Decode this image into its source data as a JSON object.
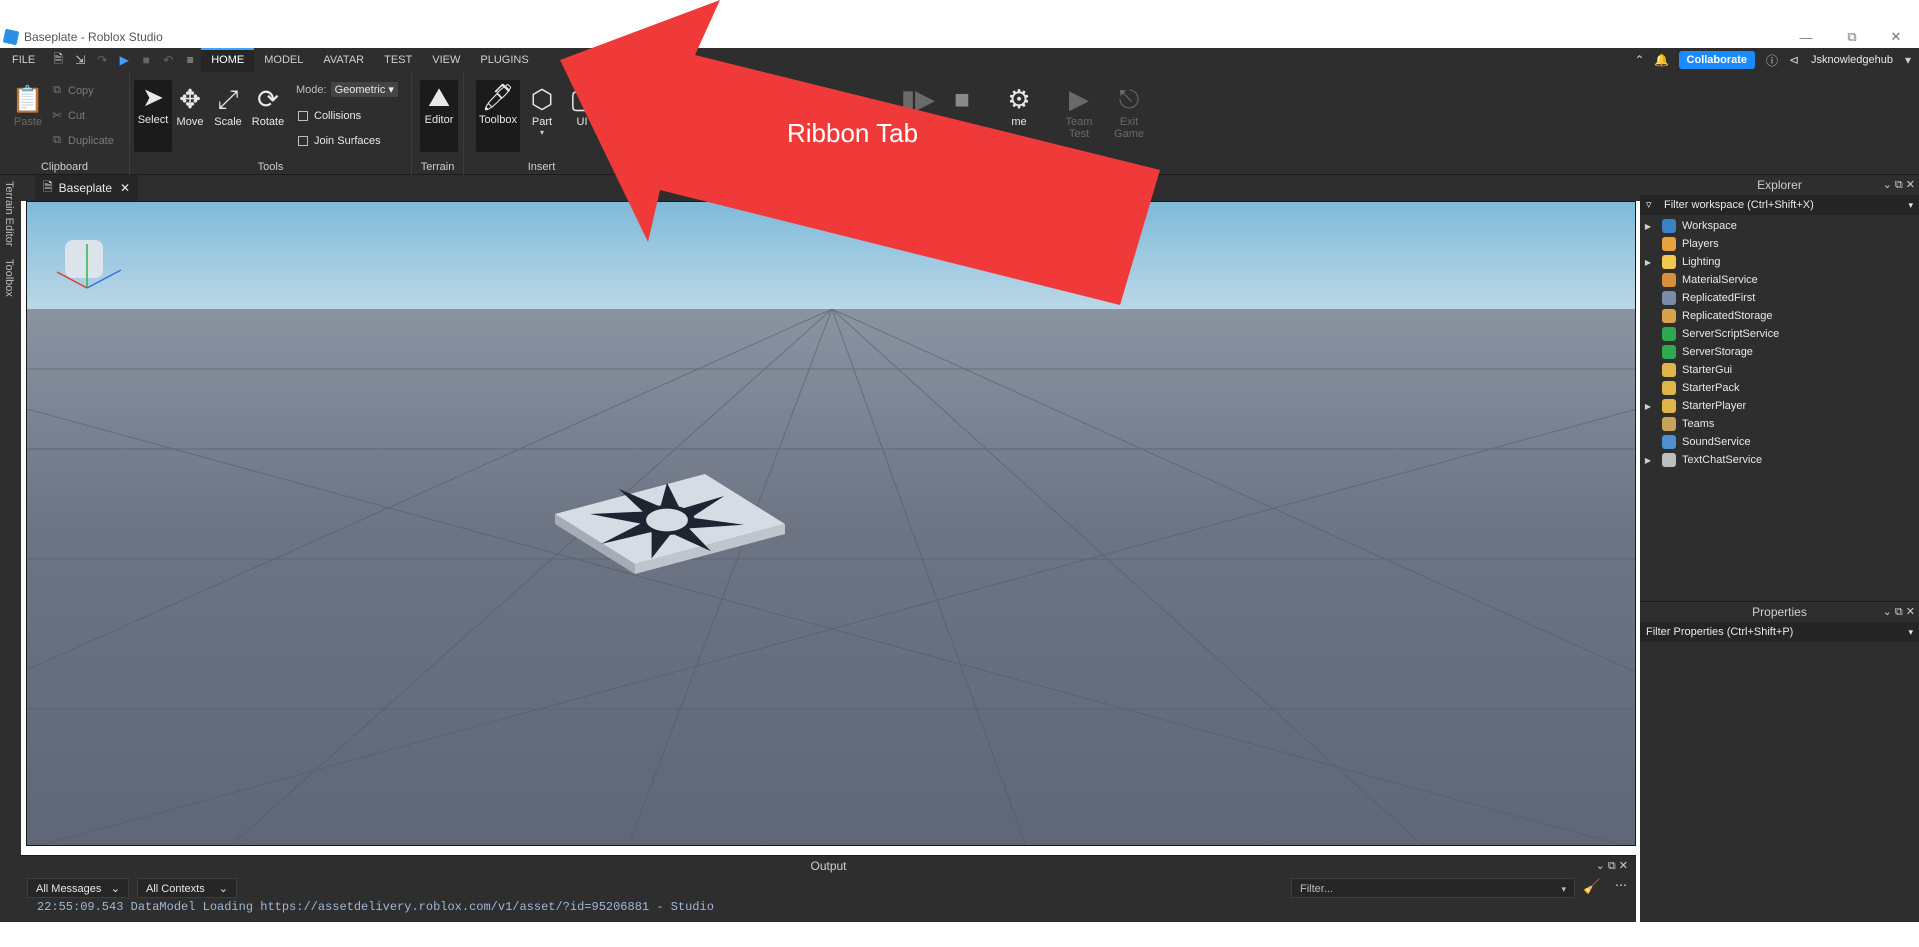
{
  "window": {
    "title": "Baseplate - Roblox Studio"
  },
  "menu": {
    "file": "FILE",
    "tabs": [
      "HOME",
      "MODEL",
      "AVATAR",
      "TEST",
      "VIEW",
      "PLUGINS"
    ],
    "collaborate": "Collaborate",
    "user": "Jsknowledgehub"
  },
  "ribbon": {
    "clipboard": {
      "paste": "Paste",
      "copy": "Copy",
      "cut": "Cut",
      "duplicate": "Duplicate",
      "label": "Clipboard"
    },
    "tools": {
      "select": "Select",
      "move": "Move",
      "scale": "Scale",
      "rotate": "Rotate",
      "mode_label": "Mode:",
      "mode_value": "Geometric",
      "collisions": "Collisions",
      "join_surfaces": "Join Surfaces",
      "label": "Tools"
    },
    "terrain": {
      "editor": "Editor",
      "label": "Terrain"
    },
    "insert": {
      "toolbox": "Toolbox",
      "part": "Part",
      "ui": "UI",
      "label": "Insert"
    },
    "game_settings_partial": "me",
    "team_test": "Team Test",
    "exit_game": "Exit Game"
  },
  "left_strip": {
    "terrain_editor": "Terrain Editor",
    "toolbox": "Toolbox"
  },
  "document_tab": {
    "label": "Baseplate"
  },
  "explorer": {
    "title": "Explorer",
    "filter_placeholder": "Filter workspace (Ctrl+Shift+X)",
    "items": [
      {
        "name": "Workspace",
        "expandable": true,
        "color": "#3b82c4"
      },
      {
        "name": "Players",
        "expandable": false,
        "color": "#e8a23b"
      },
      {
        "name": "Lighting",
        "expandable": true,
        "color": "#f2c94c"
      },
      {
        "name": "MaterialService",
        "expandable": false,
        "color": "#d98c3a"
      },
      {
        "name": "ReplicatedFirst",
        "expandable": false,
        "color": "#7a8da8"
      },
      {
        "name": "ReplicatedStorage",
        "expandable": false,
        "color": "#d6a24a"
      },
      {
        "name": "ServerScriptService",
        "expandable": false,
        "color": "#2fa84f"
      },
      {
        "name": "ServerStorage",
        "expandable": false,
        "color": "#2fa84f"
      },
      {
        "name": "StarterGui",
        "expandable": false,
        "color": "#e0b54a"
      },
      {
        "name": "StarterPack",
        "expandable": false,
        "color": "#e0b54a"
      },
      {
        "name": "StarterPlayer",
        "expandable": true,
        "color": "#e0b54a"
      },
      {
        "name": "Teams",
        "expandable": false,
        "color": "#c9a35a"
      },
      {
        "name": "SoundService",
        "expandable": false,
        "color": "#4d8fd1"
      },
      {
        "name": "TextChatService",
        "expandable": true,
        "color": "#bdbdbd"
      }
    ]
  },
  "properties": {
    "title": "Properties",
    "filter_placeholder": "Filter Properties (Ctrl+Shift+P)"
  },
  "output": {
    "title": "Output",
    "messages_filter": "All Messages",
    "contexts_filter": "All Contexts",
    "search_placeholder": "Filter...",
    "log_line": "22:55:09.543  DataModel Loading https://assetdelivery.roblox.com/v1/asset/?id=95206881  -  Studio"
  },
  "annotation": {
    "label": "Ribbon Tab",
    "color": "#f03a3a"
  }
}
